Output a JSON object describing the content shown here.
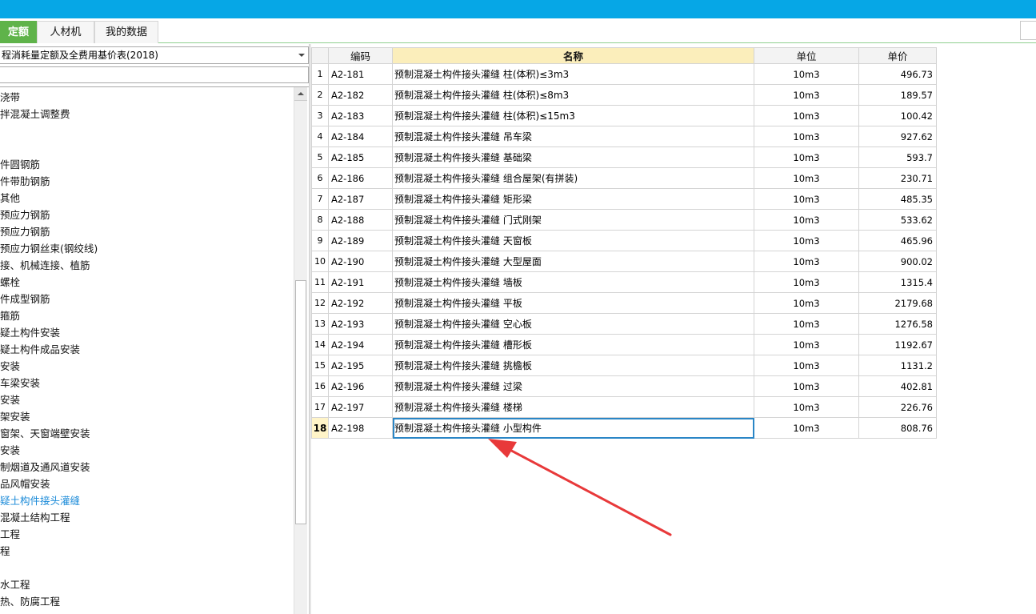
{
  "tabs": [
    {
      "label": "定额",
      "active": true
    },
    {
      "label": "人材机",
      "active": false
    },
    {
      "label": "我的数据",
      "active": false
    }
  ],
  "library_select": {
    "value": "程消耗量定额及全费用基价表(2018)"
  },
  "search": {
    "value": ""
  },
  "tree_items": [
    {
      "label": "浇带",
      "selected": false
    },
    {
      "label": "拌混凝土调整费",
      "selected": false
    },
    {
      "label": "",
      "selected": false
    },
    {
      "label": "",
      "selected": false
    },
    {
      "label": "件圆钢筋",
      "selected": false
    },
    {
      "label": "件带肋钢筋",
      "selected": false
    },
    {
      "label": "其他",
      "selected": false
    },
    {
      "label": "预应力钢筋",
      "selected": false
    },
    {
      "label": "预应力钢筋",
      "selected": false
    },
    {
      "label": "预应力钢丝束(钢绞线)",
      "selected": false
    },
    {
      "label": "接、机械连接、植筋",
      "selected": false
    },
    {
      "label": "螺栓",
      "selected": false
    },
    {
      "label": "件成型钢筋",
      "selected": false
    },
    {
      "label": "箍筋",
      "selected": false
    },
    {
      "label": "疑土构件安装",
      "selected": false
    },
    {
      "label": "疑土构件成品安装",
      "selected": false
    },
    {
      "label": "安装",
      "selected": false
    },
    {
      "label": "车梁安装",
      "selected": false
    },
    {
      "label": "安装",
      "selected": false
    },
    {
      "label": "架安装",
      "selected": false
    },
    {
      "label": "窗架、天窗端壁安装",
      "selected": false
    },
    {
      "label": "安装",
      "selected": false
    },
    {
      "label": "制烟道及通风道安装",
      "selected": false
    },
    {
      "label": "品风帽安装",
      "selected": false
    },
    {
      "label": "疑土构件接头灌缝",
      "selected": true
    },
    {
      "label": "混凝土结构工程",
      "selected": false
    },
    {
      "label": "工程",
      "selected": false
    },
    {
      "label": "程",
      "selected": false
    },
    {
      "label": "",
      "selected": false
    },
    {
      "label": "水工程",
      "selected": false
    },
    {
      "label": "热、防腐工程",
      "selected": false
    }
  ],
  "table": {
    "headers": {
      "index": "",
      "code": "编码",
      "name": "名称",
      "unit": "单位",
      "price": "单价"
    },
    "rows": [
      {
        "index": "1",
        "code": "A2-181",
        "name": "预制混凝土构件接头灌缝 柱(体积)≤3m3",
        "unit": "10m3",
        "price": "496.73"
      },
      {
        "index": "2",
        "code": "A2-182",
        "name": "预制混凝土构件接头灌缝 柱(体积)≤8m3",
        "unit": "10m3",
        "price": "189.57"
      },
      {
        "index": "3",
        "code": "A2-183",
        "name": "预制混凝土构件接头灌缝 柱(体积)≤15m3",
        "unit": "10m3",
        "price": "100.42"
      },
      {
        "index": "4",
        "code": "A2-184",
        "name": "预制混凝土构件接头灌缝 吊车梁",
        "unit": "10m3",
        "price": "927.62"
      },
      {
        "index": "5",
        "code": "A2-185",
        "name": "预制混凝土构件接头灌缝 基础梁",
        "unit": "10m3",
        "price": "593.7"
      },
      {
        "index": "6",
        "code": "A2-186",
        "name": "预制混凝土构件接头灌缝 组合屋架(有拼装)",
        "unit": "10m3",
        "price": "230.71"
      },
      {
        "index": "7",
        "code": "A2-187",
        "name": "预制混凝土构件接头灌缝 矩形梁",
        "unit": "10m3",
        "price": "485.35"
      },
      {
        "index": "8",
        "code": "A2-188",
        "name": "预制混凝土构件接头灌缝 门式刚架",
        "unit": "10m3",
        "price": "533.62"
      },
      {
        "index": "9",
        "code": "A2-189",
        "name": "预制混凝土构件接头灌缝 天窗板",
        "unit": "10m3",
        "price": "465.96"
      },
      {
        "index": "10",
        "code": "A2-190",
        "name": "预制混凝土构件接头灌缝 大型屋面",
        "unit": "10m3",
        "price": "900.02"
      },
      {
        "index": "11",
        "code": "A2-191",
        "name": "预制混凝土构件接头灌缝 墙板",
        "unit": "10m3",
        "price": "1315.4"
      },
      {
        "index": "12",
        "code": "A2-192",
        "name": "预制混凝土构件接头灌缝 平板",
        "unit": "10m3",
        "price": "2179.68"
      },
      {
        "index": "13",
        "code": "A2-193",
        "name": "预制混凝土构件接头灌缝 空心板",
        "unit": "10m3",
        "price": "1276.58"
      },
      {
        "index": "14",
        "code": "A2-194",
        "name": "预制混凝土构件接头灌缝 槽形板",
        "unit": "10m3",
        "price": "1192.67"
      },
      {
        "index": "15",
        "code": "A2-195",
        "name": "预制混凝土构件接头灌缝 挑檐板",
        "unit": "10m3",
        "price": "1131.2"
      },
      {
        "index": "16",
        "code": "A2-196",
        "name": "预制混凝土构件接头灌缝 过梁",
        "unit": "10m3",
        "price": "402.81"
      },
      {
        "index": "17",
        "code": "A2-197",
        "name": "预制混凝土构件接头灌缝 楼梯",
        "unit": "10m3",
        "price": "226.76"
      },
      {
        "index": "18",
        "code": "A2-198",
        "name": "预制混凝土构件接头灌缝 小型构件",
        "unit": "10m3",
        "price": "808.76"
      }
    ],
    "current_row_index": "18"
  },
  "colors": {
    "topbar": "#06a7e6",
    "active_tab": "#5fb34a",
    "selection": "#2a86c6",
    "arrow": "#e8393a"
  }
}
